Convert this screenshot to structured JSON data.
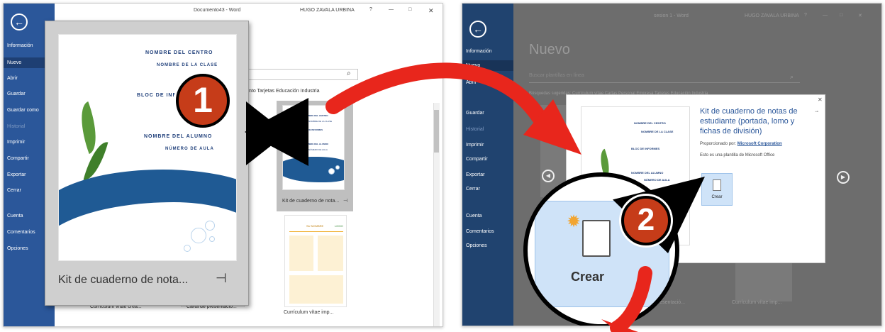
{
  "left": {
    "title": "Documento43 - Word",
    "user": "HUGO ZAVALA URBINA",
    "controls": [
      "?",
      "—",
      "□",
      "✕"
    ],
    "nav": [
      "Información",
      "Nuevo",
      "Abrir",
      "Guardar",
      "Guardar como",
      "Historial",
      "Imprimir",
      "Compartir",
      "Exportar",
      "Cerrar",
      "Cuenta",
      "Comentarios",
      "Opciones"
    ],
    "categories": "nto   Tarjetas   Educación   Industria",
    "preview_caption": "Kit de cuaderno de nota...",
    "tile_caption": "Kit de cuaderno de nota...",
    "bottom_captions": [
      "Currículum vítae crea...",
      "Carta de presentació...",
      "Currículum vítae imp..."
    ],
    "cover": {
      "line1": "NOMBRE DEL CENTRO",
      "line2": "NOMBRE DE LA CLASE",
      "line3": "BLOC DE INFORMES",
      "line4": "NOMBRE DEL ALUMNO",
      "line5": "NÚMERO DE AULA"
    },
    "resume_tile": {
      "name": "SU NOMBRE",
      "brand": "LOGO"
    }
  },
  "right": {
    "title": "sesion 1 - Word",
    "user": "HUGO ZAVALA URBINA",
    "controls": [
      "?",
      "—",
      "□",
      "✕"
    ],
    "nav": [
      "Información",
      "Nuevo",
      "Abrir",
      "Guardar",
      "Historial",
      "Imprimir",
      "Compartir",
      "Exportar",
      "Cerrar",
      "Cuenta",
      "Comentarios",
      "Opciones"
    ],
    "heading": "Nuevo",
    "search_placeholder": "Buscar plantillas en línea",
    "suggested": "Búsquedas sugeridas:   Currículum vítae   Cartas   Personal   Empresa   Tarjetas   Educación   Industria",
    "dialog": {
      "title": "Kit de cuaderno de notas de estudiante (portada, lomo y fichas de división)",
      "provided_label": "Proporcionado por:",
      "provider": "Microsoft Corporation",
      "description": "Esto es una plantilla de Microsoft Office",
      "create_label": "Crear"
    },
    "zoom_create_label": "Crear",
    "bottom_captions": [
      "presentació...",
      "Currículum vítae imp..."
    ]
  },
  "badges": [
    "1",
    "2"
  ],
  "colors": {
    "word_blue": "#2b579a",
    "arrow_red": "#e8261c",
    "badge": "#c63c19"
  }
}
